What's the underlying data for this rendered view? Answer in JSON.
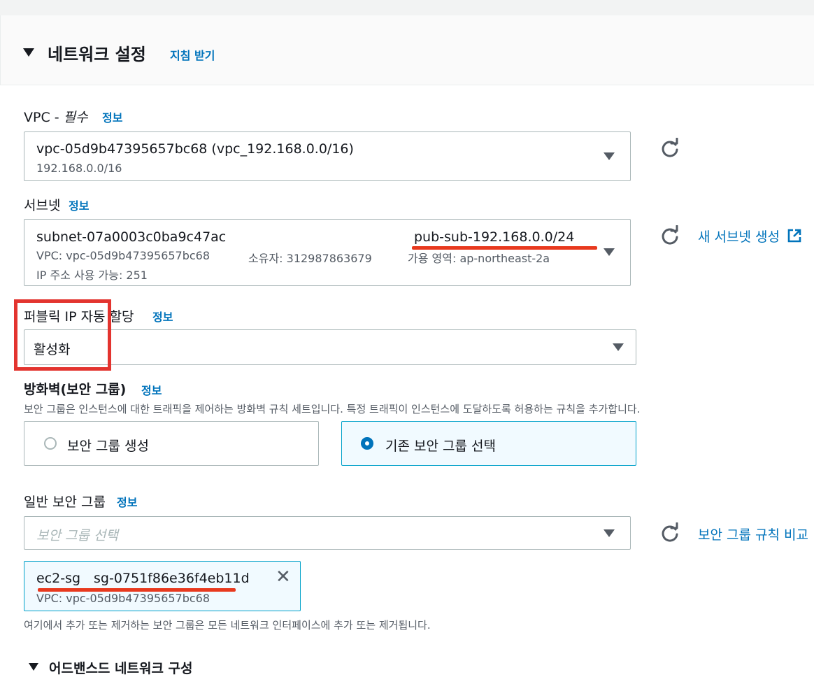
{
  "section": {
    "title": "네트워크 설정",
    "guide_link": "지침 받기"
  },
  "vpc": {
    "label": "VPC - ",
    "required": "필수",
    "info": "정보",
    "value": "vpc-05d9b47395657bc68 (vpc_192.168.0.0/16)",
    "cidr": "192.168.0.0/16"
  },
  "subnet": {
    "label": "서브넷",
    "info": "정보",
    "id": "subnet-07a0003c0ba9c47ac",
    "name": "pub-sub-192.168.0.0/24",
    "vpc": "VPC: vpc-05d9b47395657bc68",
    "owner": "소유자: 312987863679",
    "az": "가용 영역: ap-northeast-2a",
    "available_ips": "IP 주소 사용 가능: 251",
    "create_link": "새 서브넷 생성"
  },
  "public_ip": {
    "label": "퍼블릭 IP 자동 할당",
    "info": "정보",
    "value": "활성화"
  },
  "firewall": {
    "label": "방화벽(보안 그룹)",
    "info": "정보",
    "description": "보안 그룹은 인스턴스에 대한 트래픽을 제어하는 방화벽 규칙 세트입니다. 특정 트래픽이 인스턴스에 도달하도록 허용하는 규칙을 추가합니다.",
    "option_create": "보안 그룹 생성",
    "option_existing": "기존 보안 그룹 선택"
  },
  "common_sg": {
    "label": "일반 보안 그룹",
    "info": "정보",
    "placeholder": "보안 그룹 선택",
    "compare_link": "보안 그룹 규칙 비교",
    "token_name": "ec2-sg",
    "token_id": "sg-0751f86e36f4eb11d",
    "token_vpc": "VPC: vpc-05d9b47395657bc68",
    "hint": "여기에서 추가 또는 제거하는 보안 그룹은 모든 네트워크 인터페이스에 추가 또는 제거됩니다."
  },
  "advanced": {
    "title": "어드밴스드 네트워크 구성"
  },
  "colors": {
    "link": "#0073bb",
    "annotation_red": "#e3342f",
    "selected_bg": "#f1faff"
  },
  "icons": [
    "chevron-down-icon",
    "refresh-icon",
    "external-link-icon",
    "close-icon",
    "radio-icon"
  ]
}
